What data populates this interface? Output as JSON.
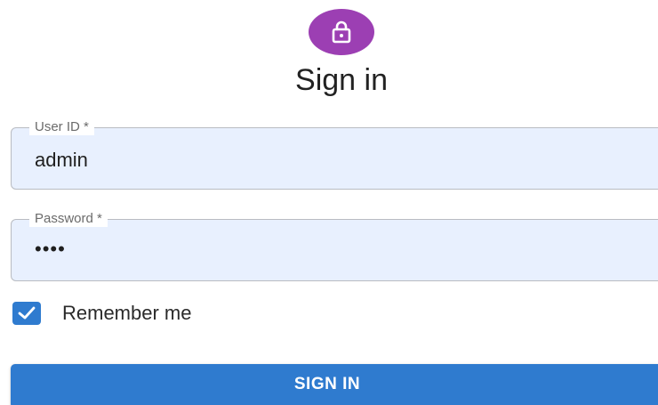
{
  "header": {
    "lock_icon": "lock-icon",
    "title": "Sign in"
  },
  "form": {
    "user_id": {
      "label": "User ID *",
      "value": "admin"
    },
    "password": {
      "label": "Password *",
      "value": "••••"
    },
    "remember_me": {
      "label": "Remember me",
      "checked": true
    },
    "submit_label": "SIGN IN"
  },
  "colors": {
    "avatar": "#9c3fb3",
    "primary": "#2f7bcf",
    "field_background": "#e8f0fe"
  }
}
